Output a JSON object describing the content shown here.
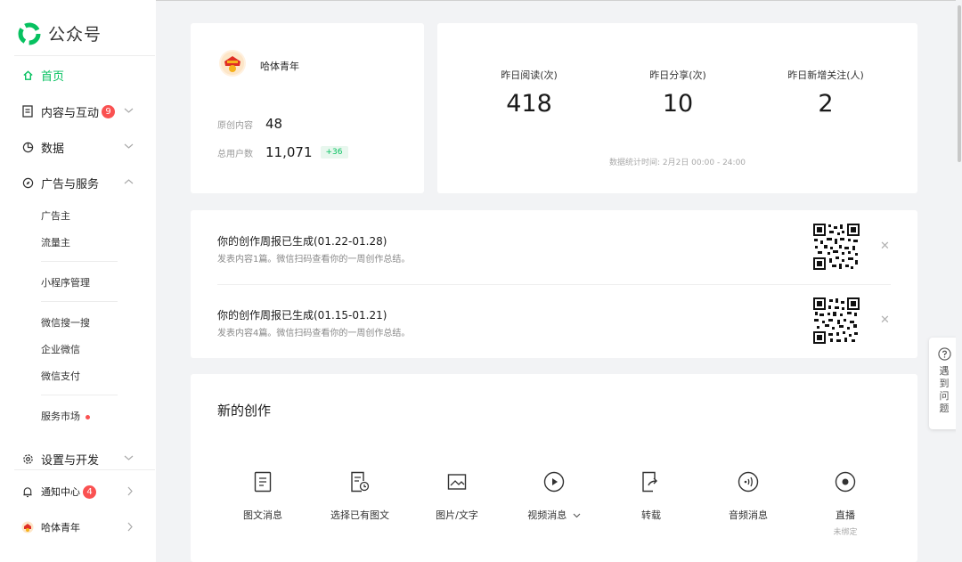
{
  "brand": {
    "title": "公众号",
    "accent": "#07c160"
  },
  "sidebar": {
    "home": "首页",
    "content": "内容与互动",
    "content_badge": "9",
    "data": "数据",
    "ads": "广告与服务",
    "sub_items": [
      "广告主",
      "流量主",
      "小程序管理",
      "微信搜一搜",
      "企业微信",
      "微信支付",
      "服务市场"
    ],
    "settings": "设置与开发",
    "notify": "通知中心",
    "notify_badge": "4",
    "account": "哈体青年"
  },
  "account": {
    "name": "哈体青年",
    "original_label": "原创内容",
    "original_value": "48",
    "users_label": "总用户数",
    "users_value": "11,071",
    "users_delta": "+36"
  },
  "stats": {
    "items": [
      {
        "label": "昨日阅读(次)",
        "value": "418"
      },
      {
        "label": "昨日分享(次)",
        "value": "10"
      },
      {
        "label": "昨日新增关注(人)",
        "value": "2"
      }
    ],
    "note": "数据统计时间: 2月2日 00:00 - 24:00"
  },
  "reports": [
    {
      "title": "你的创作周报已生成(01.22-01.28)",
      "sub": "发表内容1篇。微信扫码查看你的一周创作总结。"
    },
    {
      "title": "你的创作周报已生成(01.15-01.21)",
      "sub": "发表内容4篇。微信扫码查看你的一周创作总结。"
    }
  ],
  "create": {
    "title": "新的创作",
    "items": [
      {
        "label": "图文消息",
        "icon": "article-icon"
      },
      {
        "label": "选择已有图文",
        "icon": "existing-article-icon"
      },
      {
        "label": "图片/文字",
        "icon": "image-text-icon"
      },
      {
        "label": "视频消息",
        "icon": "video-icon"
      },
      {
        "label": "转载",
        "icon": "repost-icon"
      },
      {
        "label": "音频消息",
        "icon": "audio-icon"
      },
      {
        "label": "直播",
        "sub": "未绑定",
        "icon": "live-icon"
      }
    ]
  },
  "help": {
    "text": "遇到问题"
  }
}
